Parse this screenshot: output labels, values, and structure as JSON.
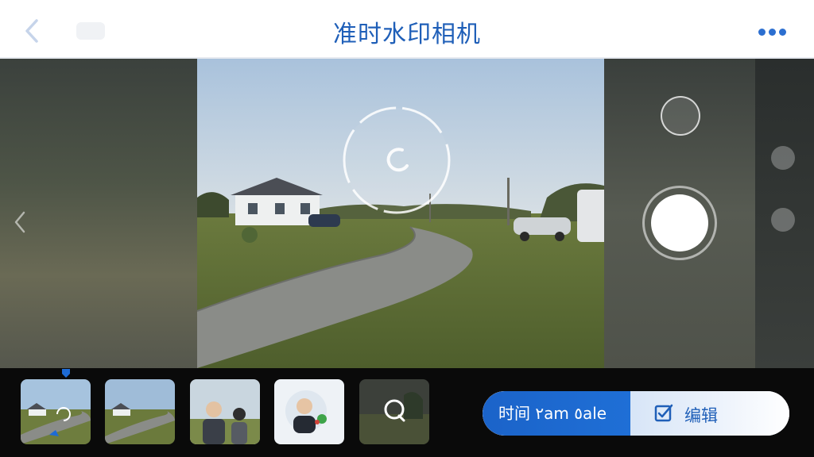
{
  "header": {
    "title": "准时水印相机",
    "back_icon": "chevron-left-icon",
    "more_icon": "more-dots-icon",
    "accent_color": "#1f5fb8"
  },
  "viewfinder": {
    "loading_icon": "loading-spinner-icon",
    "prev_icon": "chevron-left-icon"
  },
  "controls": {
    "small_button_icon": "circle-icon",
    "shutter_icon": "shutter-button-icon"
  },
  "gallery": {
    "thumbnails": [
      {
        "name": "thumbnail-1",
        "selected": true
      },
      {
        "name": "thumbnail-2",
        "selected": false
      },
      {
        "name": "thumbnail-3",
        "selected": false
      },
      {
        "name": "thumbnail-4",
        "selected": false
      },
      {
        "name": "thumbnail-5",
        "selected": false
      }
    ]
  },
  "watermark_bar": {
    "time_label": "时间 ٢am ٥ale",
    "edit_label": "编辑",
    "edit_icon": "edit-checkbox-icon",
    "primary_color": "#1b63c9"
  }
}
